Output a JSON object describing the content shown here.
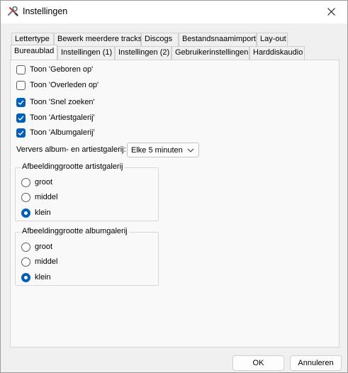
{
  "window": {
    "title": "Instellingen",
    "app_icon": "tools-icon",
    "close_icon": "close-icon"
  },
  "tabs_back_row": [
    {
      "label": "Lettertype"
    },
    {
      "label": "Bewerk meerdere tracks"
    },
    {
      "label": "Discogs"
    },
    {
      "label": "Bestandsnaamimport"
    },
    {
      "label": "Lay-out"
    }
  ],
  "tabs_front_row": [
    {
      "label": "Bureaublad",
      "active": true
    },
    {
      "label": "Instellingen (1)"
    },
    {
      "label": "Instellingen (2)"
    },
    {
      "label": "Gebruikerinstellingen"
    },
    {
      "label": "Harddiskaudio"
    }
  ],
  "checkboxes": [
    {
      "label": "Toon 'Geboren op'",
      "checked": false
    },
    {
      "label": "Toon 'Overleden op'",
      "checked": false
    },
    {
      "label": "Toon 'Snel zoeken'",
      "checked": true
    },
    {
      "label": "Toon 'Artiestgalerij'",
      "checked": true
    },
    {
      "label": "Toon 'Albumgalerij'",
      "checked": true
    }
  ],
  "refresh": {
    "label": "Ververs album- en artiestgalerij:",
    "selected": "Elke 5 minuten"
  },
  "artist_group": {
    "title": "Afbeeldinggrootte artistgalerij",
    "options": [
      {
        "label": "groot",
        "checked": false
      },
      {
        "label": "middel",
        "checked": false
      },
      {
        "label": "klein",
        "checked": true
      }
    ]
  },
  "album_group": {
    "title": "Afbeeldinggrootte albumgalerij",
    "options": [
      {
        "label": "groot",
        "checked": false
      },
      {
        "label": "middel",
        "checked": false
      },
      {
        "label": "klein",
        "checked": true
      }
    ]
  },
  "buttons": {
    "ok": "OK",
    "cancel": "Annuleren"
  },
  "colors": {
    "accent": "#005fb8"
  }
}
